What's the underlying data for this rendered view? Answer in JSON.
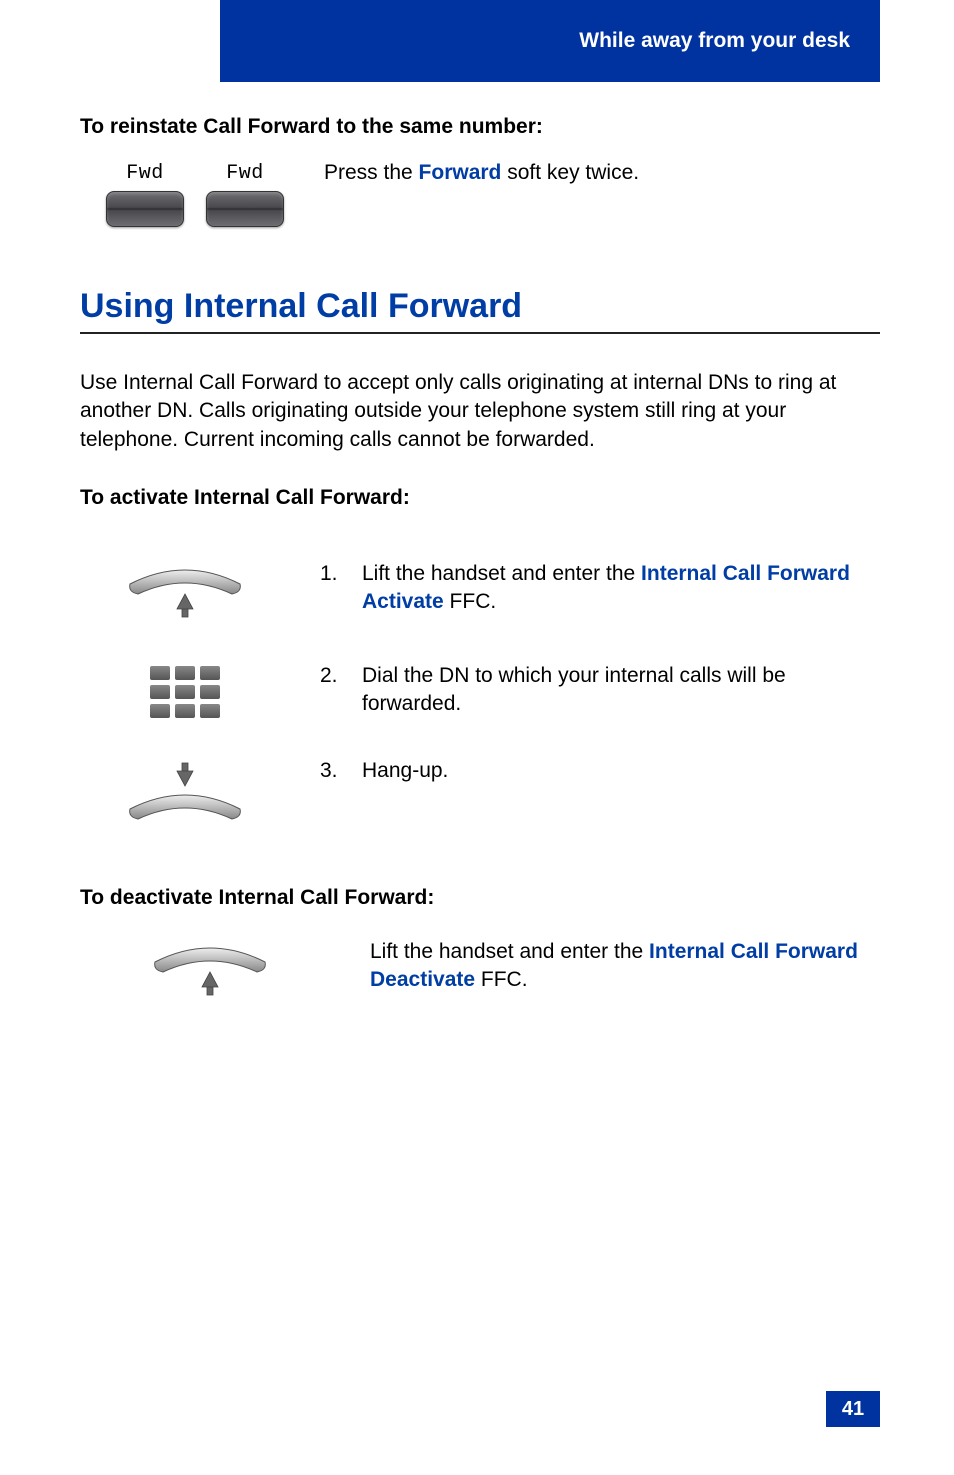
{
  "header": {
    "title": "While away from your desk"
  },
  "reinstate": {
    "heading": "To reinstate Call Forward to the same number:",
    "softkey_label": "Fwd",
    "text_pre": "Press the ",
    "text_bold": "Forward",
    "text_post": " soft key twice."
  },
  "section": {
    "title": "Using Internal Call Forward",
    "intro": "Use Internal Call Forward to accept only calls originating at internal DNs to ring at another DN. Calls originating outside your telephone system still ring at your telephone. Current incoming calls cannot be forwarded.",
    "activate_heading": "To activate Internal Call Forward:",
    "steps": [
      {
        "n": "1.",
        "pre": "Lift the handset and enter the ",
        "bold": "Internal Call Forward Activate",
        "post": " FFC."
      },
      {
        "n": "2.",
        "pre": "Dial the DN to which your internal calls will be forwarded.",
        "bold": "",
        "post": ""
      },
      {
        "n": "3.",
        "pre": "Hang-up.",
        "bold": "",
        "post": ""
      }
    ],
    "deactivate_heading": "To deactivate Internal Call Forward:",
    "deactivate": {
      "pre": "Lift the handset and enter the ",
      "bold": "Internal Call Forward Deactivate",
      "post": " FFC."
    }
  },
  "page_number": "41"
}
